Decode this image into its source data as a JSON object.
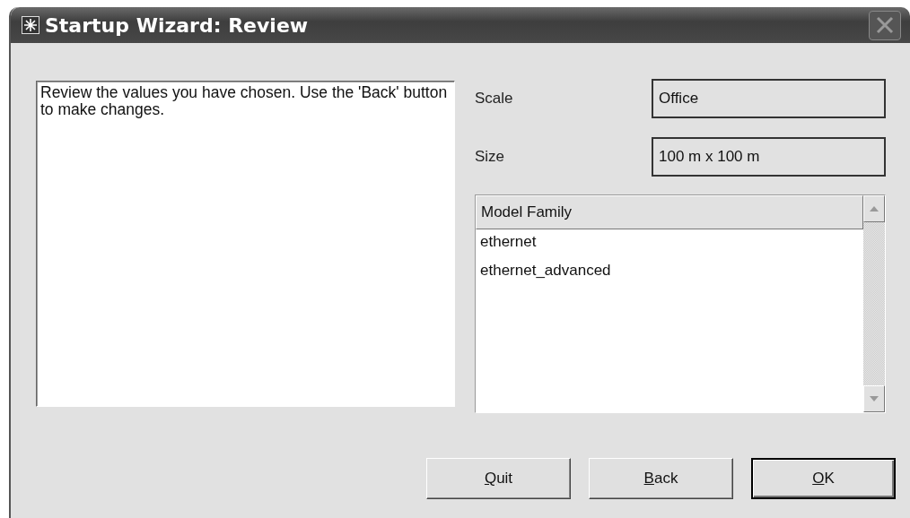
{
  "window": {
    "title": "Startup Wizard: Review"
  },
  "description": "Review the values you have chosen. Use the 'Back' button to make changes.",
  "fields": [
    {
      "label": "Scale",
      "value": "Office"
    },
    {
      "label": "Size",
      "value": "100 m x 100 m"
    }
  ],
  "list": {
    "header": "Model Family",
    "items": [
      "ethernet",
      "ethernet_advanced"
    ]
  },
  "buttons": [
    {
      "label": "Quit",
      "default": false
    },
    {
      "label": "Back",
      "default": false
    },
    {
      "label": "OK",
      "default": true
    }
  ]
}
